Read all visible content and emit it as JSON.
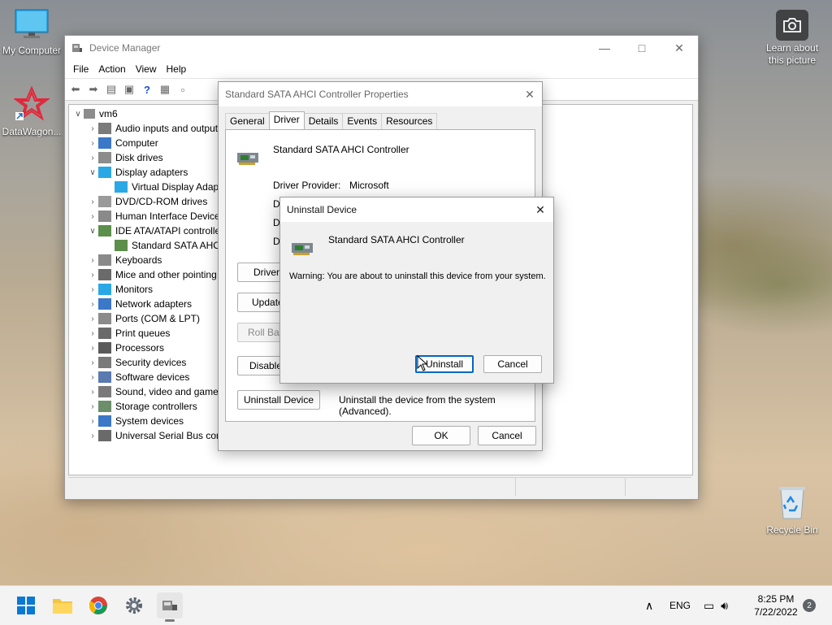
{
  "desktop": {
    "icons": [
      {
        "label": "My Computer"
      },
      {
        "label": "DataWagon..."
      },
      {
        "label": "Recycle Bin"
      }
    ],
    "learn_about": "Learn about this picture"
  },
  "device_manager": {
    "title": "Device Manager",
    "menu": [
      "File",
      "Action",
      "View",
      "Help"
    ],
    "tree": {
      "root": "vm6",
      "items": [
        {
          "label": "Audio inputs and outputs",
          "state": "collapsed"
        },
        {
          "label": "Computer",
          "state": "collapsed"
        },
        {
          "label": "Disk drives",
          "state": "collapsed"
        },
        {
          "label": "Display adapters",
          "state": "expanded"
        },
        {
          "label": "Virtual Display Adapter",
          "state": "child"
        },
        {
          "label": "DVD/CD-ROM drives",
          "state": "collapsed"
        },
        {
          "label": "Human Interface Devices",
          "state": "collapsed"
        },
        {
          "label": "IDE ATA/ATAPI controllers",
          "state": "expanded"
        },
        {
          "label": "Standard SATA AHCI Controller",
          "state": "child"
        },
        {
          "label": "Keyboards",
          "state": "collapsed"
        },
        {
          "label": "Mice and other pointing devices",
          "state": "collapsed"
        },
        {
          "label": "Monitors",
          "state": "collapsed"
        },
        {
          "label": "Network adapters",
          "state": "collapsed"
        },
        {
          "label": "Ports (COM & LPT)",
          "state": "collapsed"
        },
        {
          "label": "Print queues",
          "state": "collapsed"
        },
        {
          "label": "Processors",
          "state": "collapsed"
        },
        {
          "label": "Security devices",
          "state": "collapsed"
        },
        {
          "label": "Software devices",
          "state": "collapsed"
        },
        {
          "label": "Sound, video and game controllers",
          "state": "collapsed"
        },
        {
          "label": "Storage controllers",
          "state": "collapsed"
        },
        {
          "label": "System devices",
          "state": "collapsed"
        },
        {
          "label": "Universal Serial Bus controllers",
          "state": "collapsed"
        }
      ]
    }
  },
  "properties": {
    "title": "Standard SATA AHCI Controller Properties",
    "tabs": [
      "General",
      "Driver",
      "Details",
      "Events",
      "Resources"
    ],
    "active_tab": "Driver",
    "device_name": "Standard SATA AHCI Controller",
    "driver_provider_label": "Driver Provider:",
    "driver_provider_value": "Microsoft",
    "hidden_row_initial": "D",
    "buttons": {
      "driver_details": "Driver Details",
      "update_driver": "Update Driver",
      "roll_back": "Roll Back Driver",
      "disable": "Disable Device",
      "uninstall": "Uninstall Device"
    },
    "uninstall_desc": "Uninstall the device from the system (Advanced).",
    "ok": "OK",
    "cancel": "Cancel"
  },
  "uninstall_dialog": {
    "title": "Uninstall Device",
    "device_name": "Standard SATA AHCI Controller",
    "warning": "Warning: You are about to uninstall this device from your system.",
    "uninstall": "Uninstall",
    "cancel": "Cancel"
  },
  "taskbar": {
    "lang": "ENG",
    "time": "8:25 PM",
    "date": "7/22/2022",
    "notifications": "2"
  }
}
